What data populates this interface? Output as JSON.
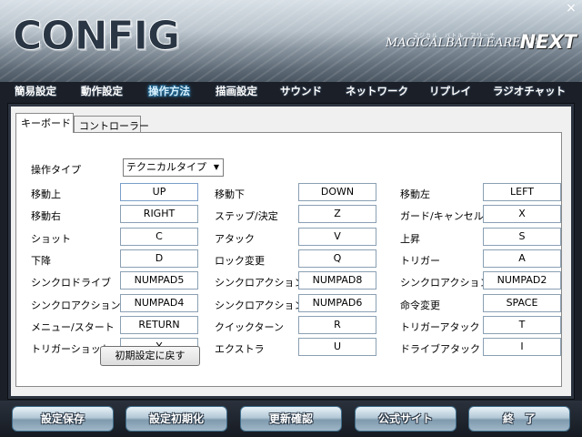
{
  "header": {
    "title": "CONFIG",
    "logo_small": "マジカル　バトル　アリーナ",
    "logo_main": "MAGICALBATTLEARENA",
    "logo_next": "NEXT",
    "close_glyph": "×"
  },
  "nav": {
    "items": [
      {
        "label": "簡易設定"
      },
      {
        "label": "動作設定"
      },
      {
        "label": "操作方法",
        "active": true
      },
      {
        "label": "描画設定"
      },
      {
        "label": "サウンド"
      },
      {
        "label": "ネットワーク"
      },
      {
        "label": "リプレイ"
      },
      {
        "label": "ラジオチャット"
      }
    ]
  },
  "tabs": {
    "keyboard": "キーボード",
    "controller": "コントローラー"
  },
  "keyboard": {
    "type_label": "操作タイプ",
    "type_value": "テクニカルタイプ",
    "rows": [
      [
        {
          "label": "移動上",
          "key": "UP"
        },
        {
          "label": "移動下",
          "key": "DOWN"
        },
        {
          "label": "移動左",
          "key": "LEFT"
        }
      ],
      [
        {
          "label": "移動右",
          "key": "RIGHT"
        },
        {
          "label": "ステップ/決定",
          "key": "Z"
        },
        {
          "label": "ガード/キャンセル",
          "key": "X"
        }
      ],
      [
        {
          "label": "ショット",
          "key": "C"
        },
        {
          "label": "アタック",
          "key": "V"
        },
        {
          "label": "上昇",
          "key": "S"
        }
      ],
      [
        {
          "label": "下降",
          "key": "D"
        },
        {
          "label": "ロック変更",
          "key": "Q"
        },
        {
          "label": "トリガー",
          "key": "A"
        }
      ],
      [
        {
          "label": "シンクロドライブ",
          "key": "NUMPAD5"
        },
        {
          "label": "シンクロアクション上",
          "key": "NUMPAD8"
        },
        {
          "label": "シンクロアクション下",
          "key": "NUMPAD2"
        }
      ],
      [
        {
          "label": "シンクロアクション左",
          "key": "NUMPAD4"
        },
        {
          "label": "シンクロアクション右",
          "key": "NUMPAD6"
        },
        {
          "label": "命令変更",
          "key": "SPACE"
        }
      ],
      [
        {
          "label": "メニュー/スタート",
          "key": "RETURN"
        },
        {
          "label": "クイックターン",
          "key": "R"
        },
        {
          "label": "トリガーアタック",
          "key": "T"
        }
      ],
      [
        {
          "label": "トリガーショット",
          "key": "Y"
        },
        {
          "label": "エクストラ",
          "key": "U"
        },
        {
          "label": "ドライブアタック",
          "key": "I"
        }
      ]
    ],
    "reset_label": "初期設定に戻す"
  },
  "footer": {
    "buttons": [
      {
        "label": "設定保存"
      },
      {
        "label": "設定初期化"
      },
      {
        "label": "更新確認"
      },
      {
        "label": "公式サイト"
      },
      {
        "label": "終　了"
      }
    ]
  },
  "colors": {
    "active_nav": "#d6f1ff",
    "panel_bg": "#f0f0f0",
    "footer_button": "#b3c8d6"
  }
}
